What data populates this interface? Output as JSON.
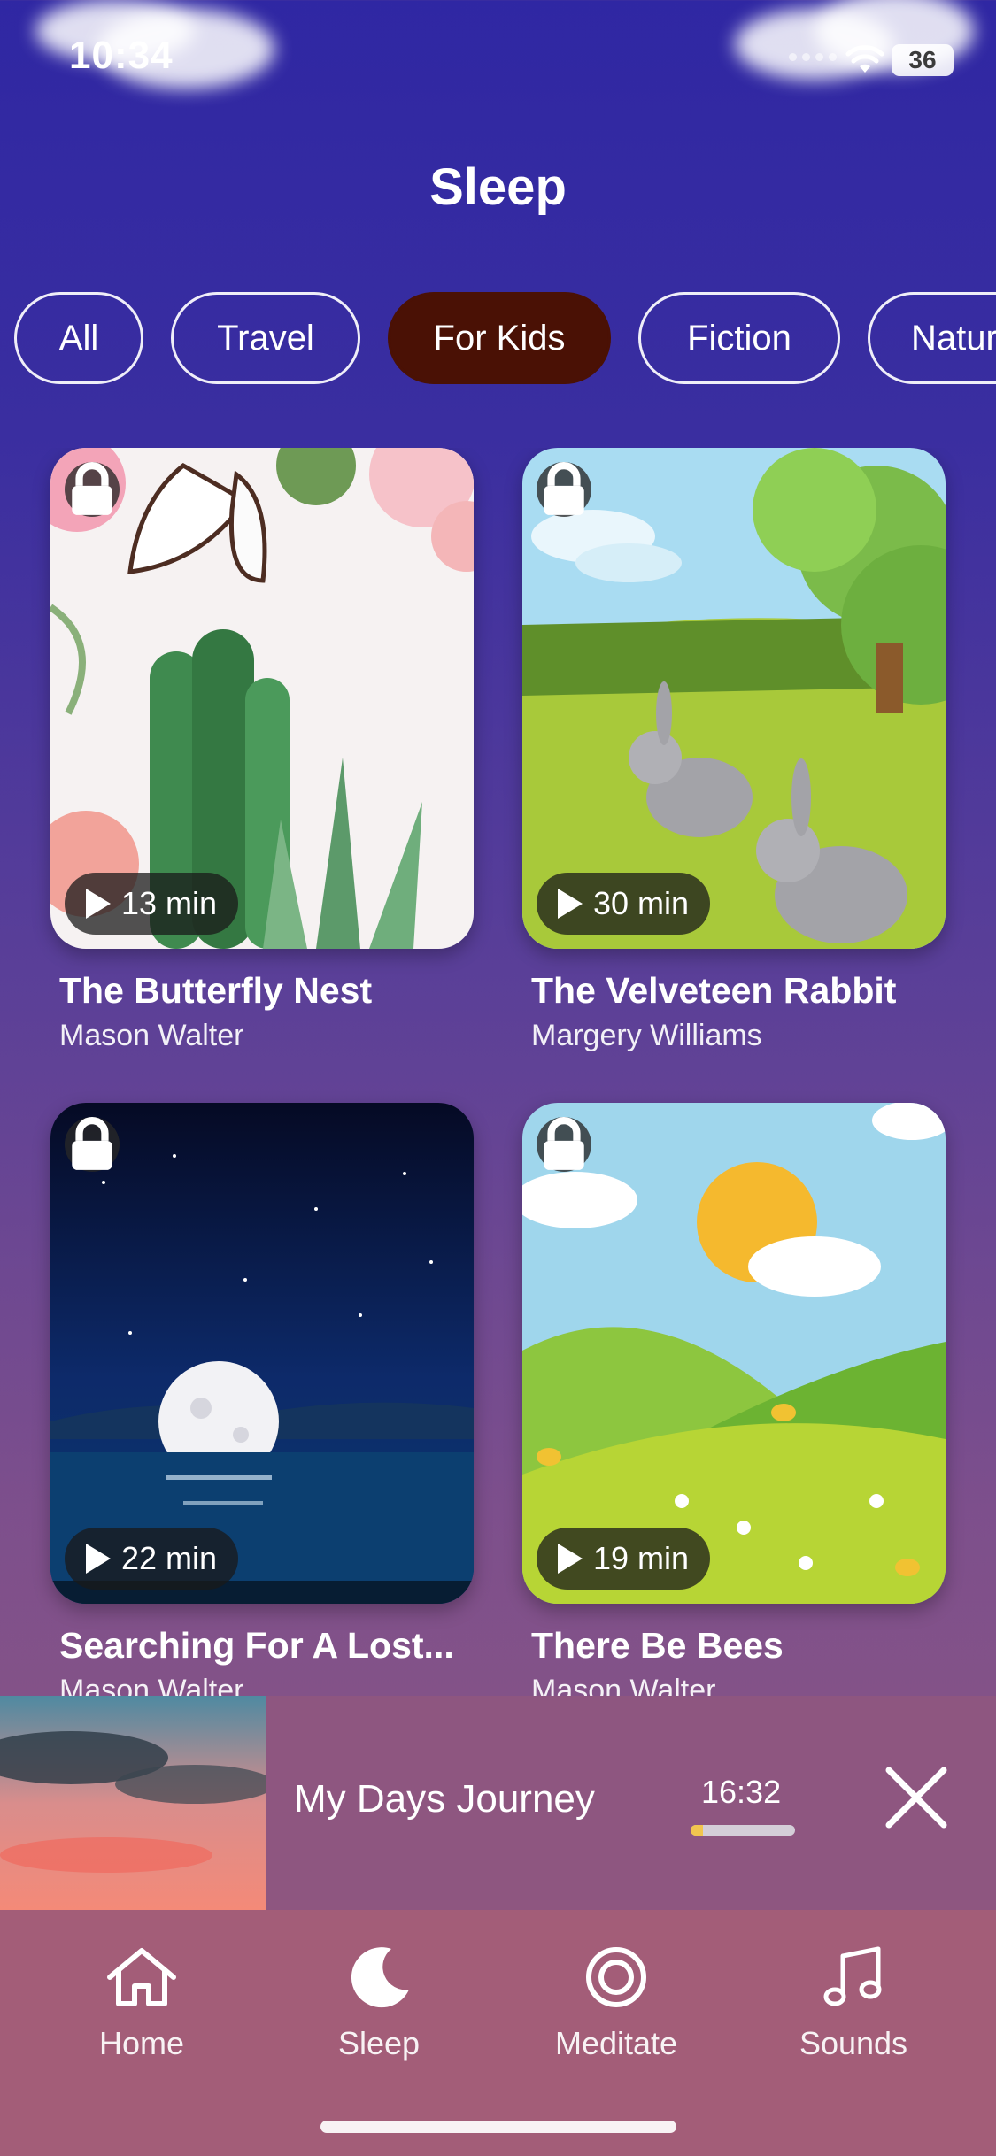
{
  "status_bar": {
    "time": "10:34",
    "battery": "36"
  },
  "header": {
    "title": "Sleep"
  },
  "filters": [
    {
      "label": "All",
      "active": false
    },
    {
      "label": "Travel",
      "active": false
    },
    {
      "label": "For Kids",
      "active": true
    },
    {
      "label": "Fiction",
      "active": false
    },
    {
      "label": "Natur",
      "active": false
    }
  ],
  "cards": [
    {
      "title": "The Butterfly Nest",
      "author": "Mason Walter",
      "duration": "13 min",
      "locked": true
    },
    {
      "title": "The Velveteen Rabbit",
      "author": "Margery Williams",
      "duration": "30 min",
      "locked": true
    },
    {
      "title": "Searching For A Lost...",
      "author": "Mason Walter",
      "duration": "22 min",
      "locked": true
    },
    {
      "title": "There Be Bees",
      "author": "Mason Walter",
      "duration": "19 min",
      "locked": true
    }
  ],
  "mini_player": {
    "title": "My Days Journey",
    "time": "16:32",
    "progress": 0.12
  },
  "tab_bar": {
    "items": [
      {
        "label": "Home",
        "icon": "house-icon"
      },
      {
        "label": "Sleep",
        "icon": "moon-icon",
        "active": true
      },
      {
        "label": "Meditate",
        "icon": "target-icon"
      },
      {
        "label": "Sounds",
        "icon": "music-note-icon"
      }
    ]
  }
}
